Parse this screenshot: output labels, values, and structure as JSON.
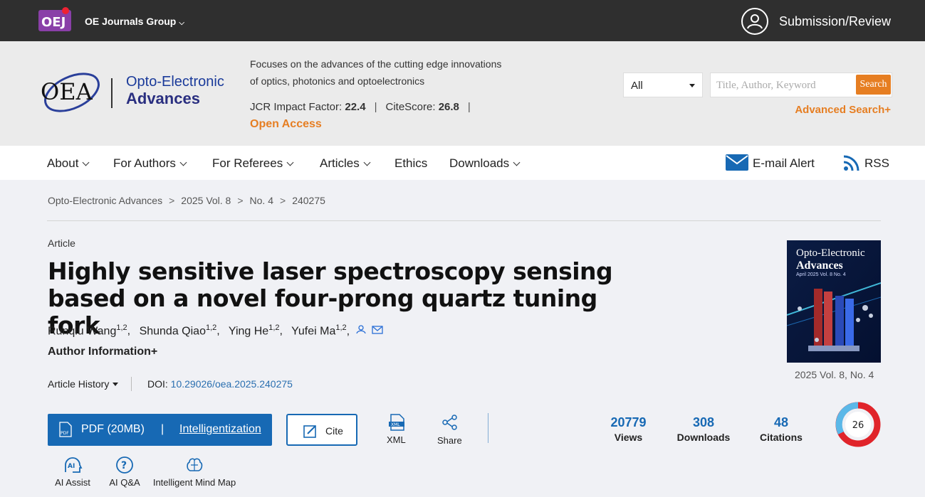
{
  "topbar": {
    "group_label": "OE Journals Group",
    "submission_label": "Submission/Review"
  },
  "header": {
    "logo_text": "OEA",
    "journal_line1": "Opto-Electronic",
    "journal_line2": "Advances",
    "tagline_line1": "Focuses on the advances of the cutting edge innovations",
    "tagline_line2": "of optics, photonics and optoelectronics",
    "jcr_label": "JCR Impact Factor:",
    "jcr_value": "22.4",
    "citescore_label": "CiteScore:",
    "citescore_value": "26.8",
    "open_access": "Open Access",
    "search_scope": "All",
    "search_placeholder": "Title, Author, Keyword",
    "search_button": "Search",
    "advanced_search": "Advanced Search+"
  },
  "nav": {
    "items": [
      "About",
      "For Authors",
      "For Referees",
      "Articles",
      "Ethics",
      "Downloads"
    ],
    "email_alert": "E-mail Alert",
    "rss": "RSS"
  },
  "breadcrumb": [
    "Opto-Electronic Advances",
    "2025 Vol. 8",
    "No. 4",
    "240275"
  ],
  "article": {
    "type": "Article",
    "title_line1": "Highly sensitive laser spectroscopy sensing",
    "title_line2": "based on a novel four-prong quartz tuning fork",
    "authors": [
      {
        "name": "Runqiu Wang",
        "aff": "1,2"
      },
      {
        "name": "Shunda Qiao",
        "aff": "1,2"
      },
      {
        "name": "Ying He",
        "aff": "1,2"
      },
      {
        "name": "Yufei Ma",
        "aff": "1,2"
      }
    ],
    "author_info": "Author Information+",
    "history": "Article History",
    "doi_label": "DOI:",
    "doi_value": "10.29026/oea.2025.240275"
  },
  "actions": {
    "pdf": "PDF (20MB)",
    "separator": "|",
    "intelligentization": "Intelligentization",
    "cite": "Cite",
    "xml": "XML",
    "share": "Share"
  },
  "stats": [
    {
      "value": "20779",
      "label": "Views"
    },
    {
      "value": "308",
      "label": "Downloads"
    },
    {
      "value": "48",
      "label": "Citations"
    }
  ],
  "altmetric_score": "26",
  "tools": [
    "AI Assist",
    "AI Q&A",
    "Intelligent Mind Map"
  ],
  "cover": {
    "title1": "Opto-Electronic",
    "title2": "Advances",
    "small": "April 2025 Vol. 8 No. 4",
    "caption": "2025 Vol. 8, No. 4"
  },
  "colors": {
    "accent_orange": "#e67e22",
    "primary_blue": "#1769b4",
    "topbar": "#2f2f2f"
  }
}
